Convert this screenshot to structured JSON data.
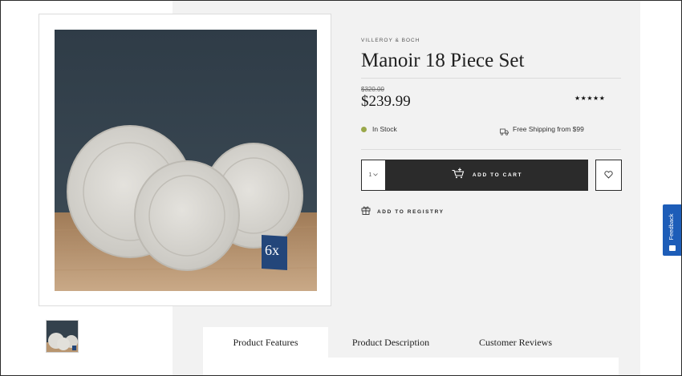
{
  "product": {
    "brand": "VILLEROY & BOCH",
    "title": "Manoir 18 Piece Set",
    "old_price": "$320.00",
    "price": "$239.99",
    "rating_stars": "★★★★★",
    "stock_status": "In Stock",
    "shipping": "Free Shipping from $99",
    "image_badge": "6x"
  },
  "purchase": {
    "quantity": "1",
    "add_to_cart": "ADD TO CART",
    "add_to_registry": "ADD TO REGISTRY"
  },
  "tabs": [
    {
      "label": "Product Features"
    },
    {
      "label": "Product Description"
    },
    {
      "label": "Customer Reviews"
    }
  ],
  "feedback": {
    "label": "Feedback"
  },
  "colors": {
    "accent_dark": "#2b2b2b",
    "stock_green": "#9aa84a",
    "feedback_blue": "#1d5db8",
    "panel_gray": "#f2f2f2"
  },
  "icons": [
    "cart-icon",
    "heart-icon",
    "gift-icon",
    "truck-icon",
    "chevron-down-icon",
    "feedback-icon"
  ]
}
